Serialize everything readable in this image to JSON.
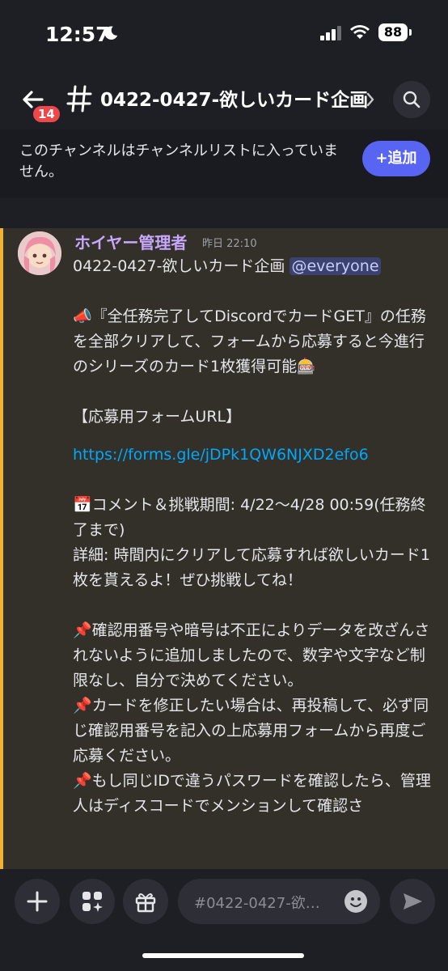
{
  "status": {
    "time": "12:57",
    "battery": "88"
  },
  "header": {
    "notif_count": "14",
    "channel_name": "0422-0427-欲しいカード企画"
  },
  "banner": {
    "text": "このチャンネルはチャンネルリストに入っていません。",
    "add_label": "+追加"
  },
  "message": {
    "author": "ホイヤー管理者",
    "timestamp": "昨日 22:10",
    "line1": "0422-0427-欲しいカード企画 ",
    "mention": "@everyone",
    "p1": "📣『全任務完了してDiscordでカードGET』の任務を全部クリアして、フォームから応募すると今進行のシリーズのカード1枚獲得可能🎰",
    "form_header": "【応募用フォームURL】",
    "form_url": "https://forms.gle/jDPk1QW6NJXD2efo6",
    "period": "📅コメント＆挑戦期間: 4/22〜4/28 00:59(任務終了まで)",
    "details": "詳細: 時間内にクリアして応募すれば欲しいカード1枚を貰えるよ！ぜひ挑戦してね！",
    "note1": "📌確認用番号や暗号は不正によりデータを改ざんされないように追加しましたので、数字や文字など制限なし、自分で決めてください。",
    "note2": "📌カードを修正したい場合は、再投稿して、必ず同じ確認用番号を記入の上応募用フォームから再度ご応募ください。",
    "note3": "📌もし同じIDで違うパスワードを確認したら、管理人はディスコードでメンションして確認さ"
  },
  "composer": {
    "placeholder": "#0422-0427-欲…"
  },
  "colors": {
    "accent": "#5865f2",
    "highlight_bar": "#f0b232",
    "badge": "#f0474b",
    "link": "#00a8fc"
  }
}
